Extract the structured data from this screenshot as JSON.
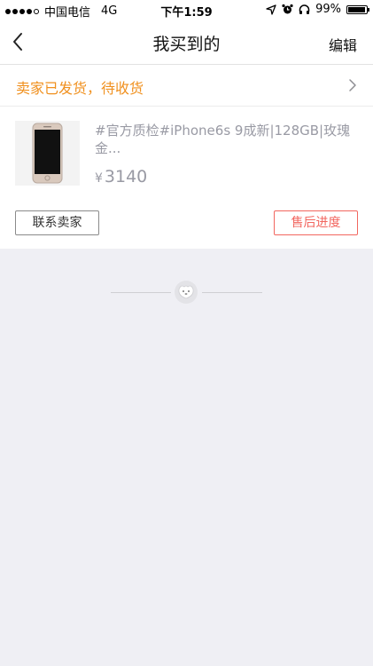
{
  "status_bar": {
    "carrier": "中国电信",
    "network": "4G",
    "time": "下午1:59",
    "battery": "99%",
    "battery_level": 0.99
  },
  "nav": {
    "title": "我买到的",
    "edit_label": "编辑",
    "back_icon": "chevron-left-icon"
  },
  "order": {
    "status_text": "卖家已发货，待收货",
    "product": {
      "title": "#官方质检#iPhone6s 9成新|128GB|玫瑰金...",
      "currency": "¥",
      "price": "3140"
    },
    "buttons": {
      "contact_seller": "联系卖家",
      "after_sale": "售后进度"
    }
  },
  "colors": {
    "status_orange": "#f0901e",
    "after_sale_red": "#f2665f",
    "muted_text": "#999aa4",
    "background": "#efeff4"
  }
}
